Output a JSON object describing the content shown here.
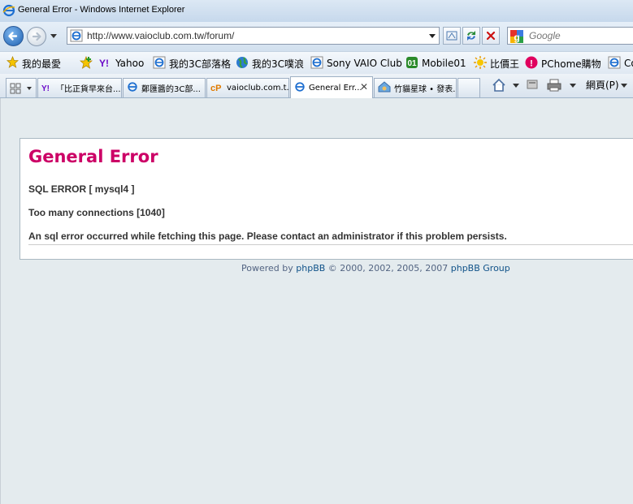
{
  "window": {
    "title": "General Error - Windows Internet Explorer"
  },
  "nav": {
    "url": "http://www.vaioclub.com.tw/forum/",
    "search_placeholder": "Google"
  },
  "favorites": [
    {
      "label": "我的最愛",
      "icon": "star-icon"
    },
    {
      "label": "Yahoo",
      "icon": "yahoo-icon"
    },
    {
      "label": "我的3C部落格",
      "icon": "ie-page-icon"
    },
    {
      "label": "我的3C噗浪",
      "icon": "globe-icon"
    },
    {
      "label": "Sony VAIO Club",
      "icon": "ie-page-icon"
    },
    {
      "label": "Mobile01",
      "icon": "mobile01-icon"
    },
    {
      "label": "比價王",
      "icon": "sun-icon"
    },
    {
      "label": "PChome購物",
      "icon": "pchome-icon"
    },
    {
      "label": "Co",
      "icon": "ie-page-icon"
    }
  ],
  "tabs": [
    {
      "label": "「比正貨早來台...",
      "icon": "yahoo-icon",
      "active": false
    },
    {
      "label": "鄭匯醬的3C部...",
      "icon": "ie-page-icon",
      "active": false
    },
    {
      "label": "vaioclub.com.t...",
      "icon": "cp-icon",
      "active": false
    },
    {
      "label": "General Err...",
      "icon": "ie-page-icon",
      "active": true
    },
    {
      "label": "竹貓星球 • 發表...",
      "icon": "house-cat-icon",
      "active": false
    }
  ],
  "commandbar": {
    "page_label": "網頁(P)"
  },
  "page": {
    "heading": "General Error",
    "line1": "SQL ERROR [ mysql4 ]",
    "line2": "Too many connections [1040]",
    "line3": "An sql error occurred while fetching this page. Please contact an administrator if this problem persists.",
    "footer_prefix": "Powered by",
    "footer_phpbb": "phpBB",
    "footer_years": "© 2000, 2002, 2005, 2007",
    "footer_group": "phpBB Group"
  },
  "colors": {
    "heading": "#cc0066",
    "link": "#105289",
    "page_bg": "#e4ebee"
  }
}
